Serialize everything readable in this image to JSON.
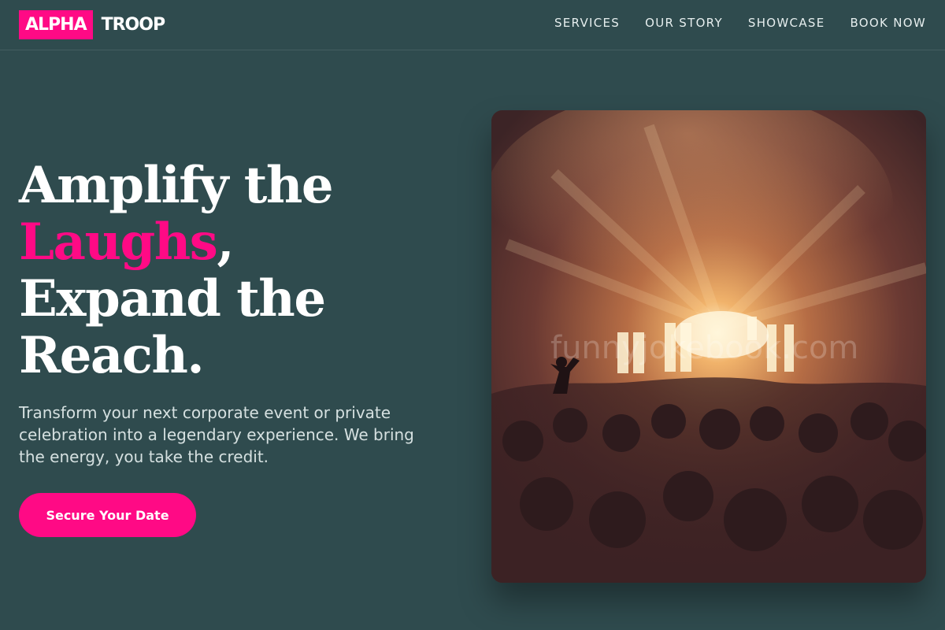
{
  "brand": {
    "logo_primary": "ALPHA",
    "logo_secondary": "TROOP",
    "accent_color": "#ff0a85",
    "background_color": "#2f4b4e"
  },
  "nav": {
    "items": [
      {
        "label": "SERVICES"
      },
      {
        "label": "OUR STORY"
      },
      {
        "label": "SHOWCASE"
      },
      {
        "label": "BOOK NOW"
      }
    ]
  },
  "hero": {
    "title_line1": "Amplify the",
    "title_accent": "Laughs",
    "title_comma": ",",
    "title_line3": "Expand the",
    "title_line4": "Reach.",
    "description": "Transform your next corporate event or private celebration into a legendary experience. We bring the energy, you take the credit.",
    "cta_label": "Secure Your Date"
  },
  "image": {
    "alt": "Concert crowd in front of a brightly lit stage",
    "watermark": "funnyjokebook.com"
  }
}
